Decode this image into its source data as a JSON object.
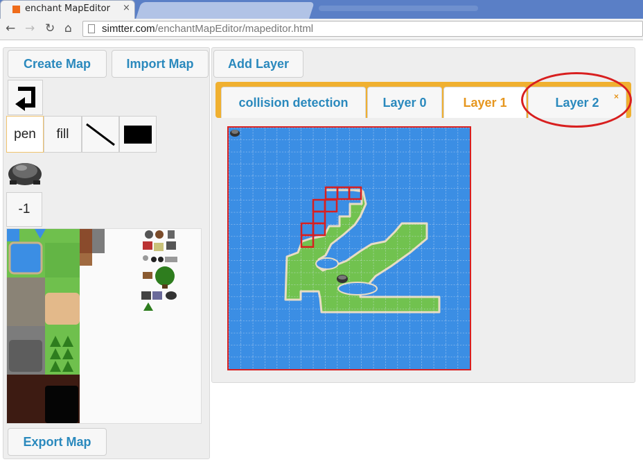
{
  "browser": {
    "tab_title": "enchant MapEditor",
    "tab_close": "×",
    "url_domain": "simtter.com",
    "url_path": "/enchantMapEditor/mapeditor.html",
    "nav_icons": [
      "back-arrow-icon",
      "forward-arrow-icon",
      "reload-icon",
      "home-icon"
    ]
  },
  "toolbar": {
    "create_map": "Create Map",
    "import_map": "Import Map",
    "add_layer": "Add Layer",
    "export_map": "Export Map"
  },
  "tools": {
    "pen": "pen",
    "fill": "fill",
    "tile_index": "-1",
    "undo_icon": "undo-arrow-icon",
    "line_icon": "line-tool-icon",
    "rect_icon": "rectangle-tool-icon",
    "selected_tile_icon": "rock-tile-icon"
  },
  "layers": {
    "tabs": [
      {
        "label": "collision detection",
        "selected": false
      },
      {
        "label": "Layer 0",
        "selected": false
      },
      {
        "label": "Layer 1",
        "selected": true
      },
      {
        "label": "Layer 2",
        "selected": false
      }
    ],
    "close_symbol": "×"
  },
  "colors": {
    "accent_blue": "#2a89bd",
    "tab_orange": "#f0b030",
    "selected_tab_text": "#e6961e",
    "water": "#3b8ee4",
    "grass": "#71c24f",
    "highlight_red": "#d81f1f"
  }
}
